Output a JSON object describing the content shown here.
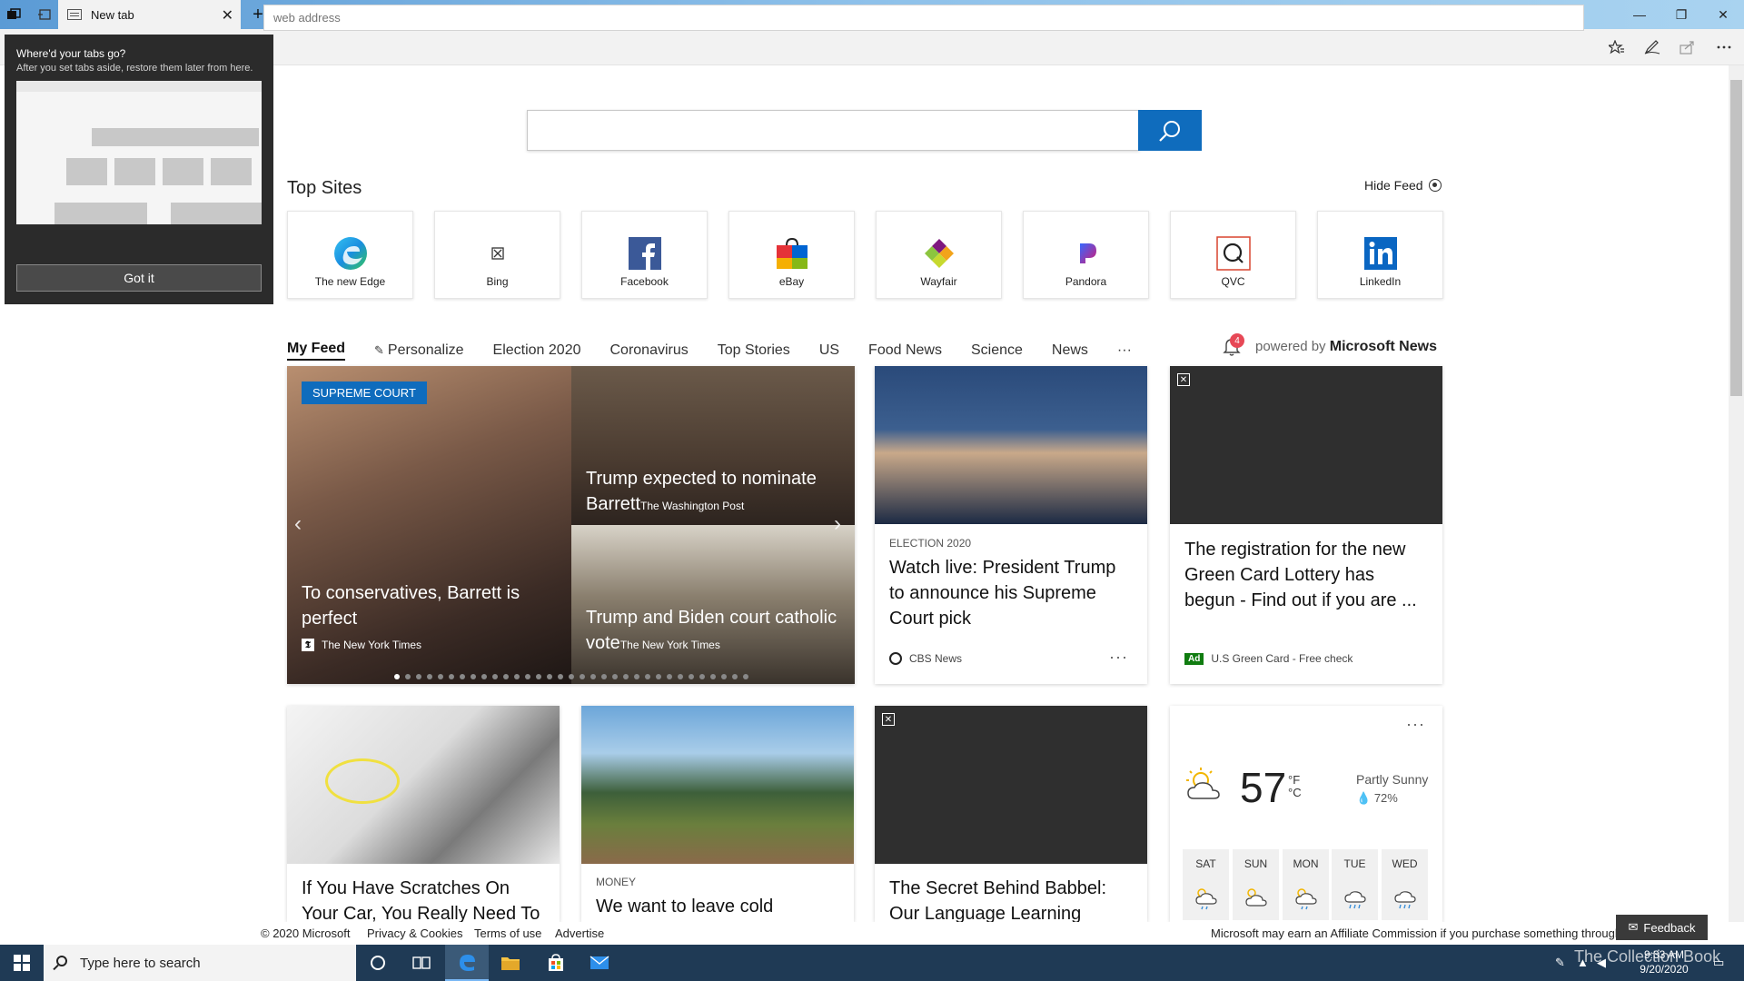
{
  "browser": {
    "tab_title": "New tab",
    "address_placeholder": "web address",
    "tab_close_glyph": "✕",
    "new_tab_glyph": "+",
    "tab_menu_glyph": "⌄",
    "minimize_glyph": "—",
    "restore_glyph": "❐",
    "close_glyph": "✕"
  },
  "popup": {
    "title": "Where'd your tabs go?",
    "body": "After you set tabs aside, restore them later from here.",
    "button": "Got it"
  },
  "page": {
    "top_sites_title": "Top Sites",
    "hide_feed": "Hide Feed",
    "top_sites": [
      {
        "label": "The new Edge",
        "icon": "edge-logo-icon"
      },
      {
        "label": "Bing",
        "icon": "broken-image-icon"
      },
      {
        "label": "Facebook",
        "icon": "facebook-logo-icon"
      },
      {
        "label": "eBay",
        "icon": "ebay-bag-icon"
      },
      {
        "label": "Wayfair",
        "icon": "wayfair-logo-icon"
      },
      {
        "label": "Pandora",
        "icon": "pandora-logo-icon"
      },
      {
        "label": "QVC",
        "icon": "qvc-logo-icon"
      },
      {
        "label": "LinkedIn",
        "icon": "linkedin-logo-icon"
      }
    ],
    "feed_tabs": [
      "My Feed",
      "Personalize",
      "Election 2020",
      "Coronavirus",
      "Top Stories",
      "US",
      "Food News",
      "Science",
      "News",
      "···"
    ],
    "notification_count": "4",
    "powered_by": "powered by",
    "powered_brand": "Microsoft News"
  },
  "hero": {
    "tag": "SUPREME COURT",
    "story1_title": "To conservatives, Barrett is perfect",
    "story1_source": "The New York Times",
    "story2_title": "Trump expected to nominate Barrett",
    "story2_source": "The Washington Post",
    "story3_title": "Trump and Biden court catholic vote",
    "story3_source": "The New York Times",
    "prev": "‹",
    "next": "›"
  },
  "cards": {
    "trump": {
      "category": "ELECTION 2020",
      "headline": "Watch live: President Trump to announce his Supreme Court pick",
      "source": "CBS News",
      "more": "···"
    },
    "greencard": {
      "headline": "The registration for the new Green Card Lottery has begun - Find out if you are ...",
      "ad_label": "Ad",
      "source": "U.S Green Card - Free check"
    },
    "scratches": {
      "headline": "If You Have Scratches On Your Car, You Really Need To"
    },
    "money": {
      "category": "MONEY",
      "headline": "We want to leave cold"
    },
    "babbel": {
      "headline": "The Secret Behind Babbel: Our Language Learning"
    }
  },
  "weather": {
    "temp": "57",
    "unit_f": "°F",
    "unit_c": "°C",
    "condition": "Partly Sunny",
    "humidity": "72%",
    "more": "···",
    "days": [
      "SAT",
      "SUN",
      "MON",
      "TUE",
      "WED"
    ]
  },
  "footer": {
    "copyright": "© 2020 Microsoft",
    "privacy": "Privacy & Cookies",
    "terms": "Terms of use",
    "advertise": "Advertise",
    "affiliate": "Microsoft may earn an Affiliate Commission if you purchase something through",
    "feedback": "Feedback"
  },
  "taskbar": {
    "search_placeholder": "Type here to search",
    "time": "9:33 AM",
    "date": "9/20/2020",
    "watermark": "The Collection Book"
  },
  "colors": {
    "accent": "#0f6cbd",
    "taskbar": "#1f3a55",
    "popup": "#2b2b2b"
  }
}
